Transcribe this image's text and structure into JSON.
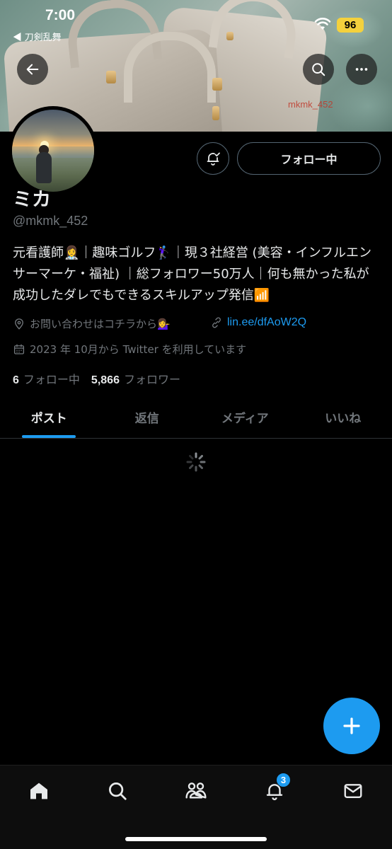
{
  "status_bar": {
    "time": "7:00",
    "back_app": "◀ 刀剣乱舞",
    "battery": "96"
  },
  "banner": {
    "watermark": "mkmk_452"
  },
  "profile": {
    "name": "ミカ",
    "handle": "@mkmk_452",
    "bio": "元看護師👩‍⚕️｜趣味ゴルフ🏌️‍♀️｜現３社経営 (美容・インフルエンサーマーケ・福祉) ｜総フォロワー50万人｜何も無かった私が成功したダレでもできるスキルアップ発信📶",
    "location": "お問い合わせはコチラから💁‍♀️",
    "link": "lin.ee/dfAoW2Q",
    "joined": "2023 年 10月から Twitter を利用しています",
    "following_count": "6",
    "following_label": "フォロー中",
    "followers_count": "5,866",
    "followers_label": "フォロワー"
  },
  "actions": {
    "follow_label": "フォロー中"
  },
  "tabs": [
    {
      "label": "ポスト",
      "active": true
    },
    {
      "label": "返信",
      "active": false
    },
    {
      "label": "メディア",
      "active": false
    },
    {
      "label": "いいね",
      "active": false
    }
  ],
  "bottom_nav": {
    "notifications_badge": "3",
    "items": [
      "home-icon",
      "search-icon",
      "communities-icon",
      "notifications-icon",
      "messages-icon"
    ]
  },
  "colors": {
    "accent": "#1d9bf0",
    "background": "#000000",
    "secondary_text": "#71767b"
  }
}
